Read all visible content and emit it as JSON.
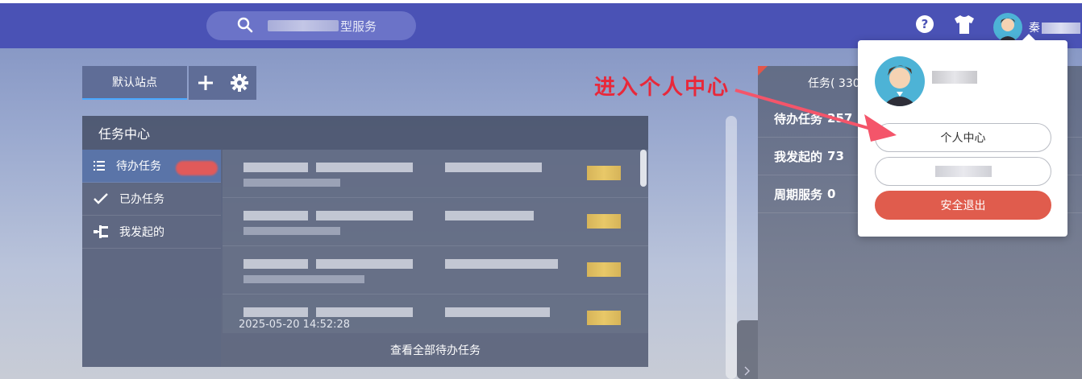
{
  "topbar": {
    "search": {
      "text_suffix": "型服务",
      "icon": "search-icon"
    },
    "icons": [
      "help-icon",
      "shirt-icon"
    ],
    "user_name_visible": "秦"
  },
  "station": {
    "tab_label": "默认站点",
    "add_icon": "plus-icon",
    "settings_icon": "gear-icon"
  },
  "task_center": {
    "title": "任务中心",
    "nav": [
      {
        "label": "待办任务",
        "icon": "list-icon"
      },
      {
        "label": "已办任务",
        "icon": "check-icon"
      },
      {
        "label": "我发起的",
        "icon": "tree-icon"
      }
    ],
    "last_date": "2025-05-20 14:52:28",
    "view_all_label": "查看全部待办任务"
  },
  "right_panel": {
    "tab_label": "任务( 330",
    "stats": [
      {
        "label": "待办任务",
        "value": "257"
      },
      {
        "label": "我发起的",
        "value": "73"
      },
      {
        "label": "周期服务",
        "value": "0"
      }
    ]
  },
  "user_dropdown": {
    "personal_center_label": "个人中心",
    "logout_label": "安全退出"
  },
  "annotation": {
    "text": "进入个人中心",
    "color": "#e8283a"
  },
  "colors": {
    "topbar": "#4a52b5",
    "logout": "#e05c4d",
    "accent": "#4aa8ff"
  }
}
